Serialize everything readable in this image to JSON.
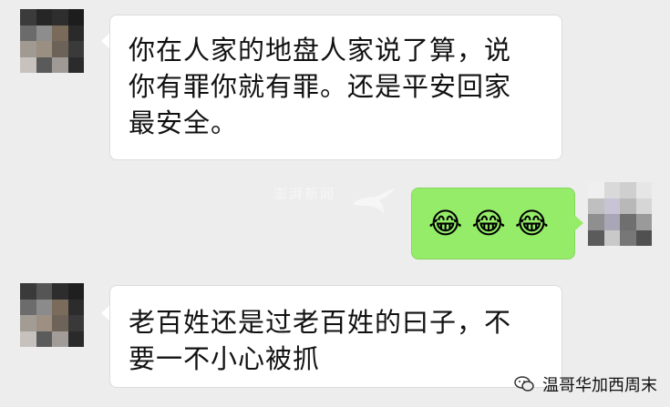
{
  "messages": [
    {
      "side": "left",
      "text": "你在人家的地盘人家说了算，说\n你有罪你就有罪。还是平安回家\n最安全。"
    },
    {
      "side": "right",
      "emoji": [
        "😂",
        "😂",
        "😂"
      ]
    },
    {
      "side": "left",
      "text": "老百姓还是过老百姓的曰子，不\n要一不小心被抓"
    }
  ],
  "watermark": {
    "middle": "澎湃新闻"
  },
  "footer": {
    "account": "温哥华加西周末"
  },
  "colors": {
    "background": "#ededed",
    "incoming_bubble": "#ffffff",
    "outgoing_bubble": "#95ec69"
  }
}
